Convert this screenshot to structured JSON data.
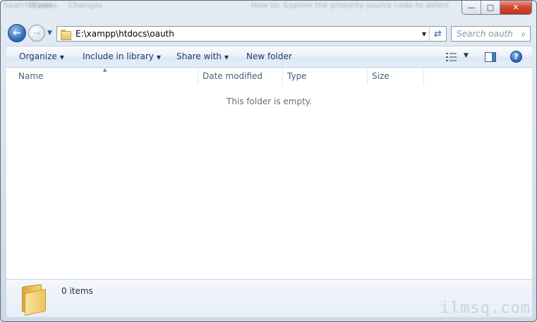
{
  "window": {
    "background_snippets": [
      "Search Code",
      "Browse",
      "Changes",
      "How to: Explore the property source code to determine, Browse, search"
    ],
    "minimize": "—",
    "maximize": "□",
    "close": "✕"
  },
  "navigation": {
    "back_glyph": "←",
    "forward_glyph": "→",
    "recent_glyph": "▼"
  },
  "address_bar": {
    "path": "E:\\xampp\\htdocs\\oauth",
    "dropdown_glyph": "▼",
    "refresh_glyph": "⇄"
  },
  "search": {
    "placeholder": "Search oauth",
    "icon_glyph": "⌕"
  },
  "toolbar": {
    "organize": "Organize",
    "include_in_library": "Include in library",
    "share_with": "Share with",
    "new_folder": "New folder",
    "caret": "▼",
    "help_glyph": "?"
  },
  "columns": {
    "name": "Name",
    "date_modified": "Date modified",
    "type": "Type",
    "size": "Size",
    "sort_glyph": "▲"
  },
  "content": {
    "empty_message": "This folder is empty."
  },
  "details_pane": {
    "item_count": "0 items"
  },
  "watermark": {
    "text": "ilmsq.com"
  },
  "colors": {
    "toolbar_text": "#1e395b",
    "close_button": "#c0331c",
    "folder_yellow": "#eec45c"
  }
}
